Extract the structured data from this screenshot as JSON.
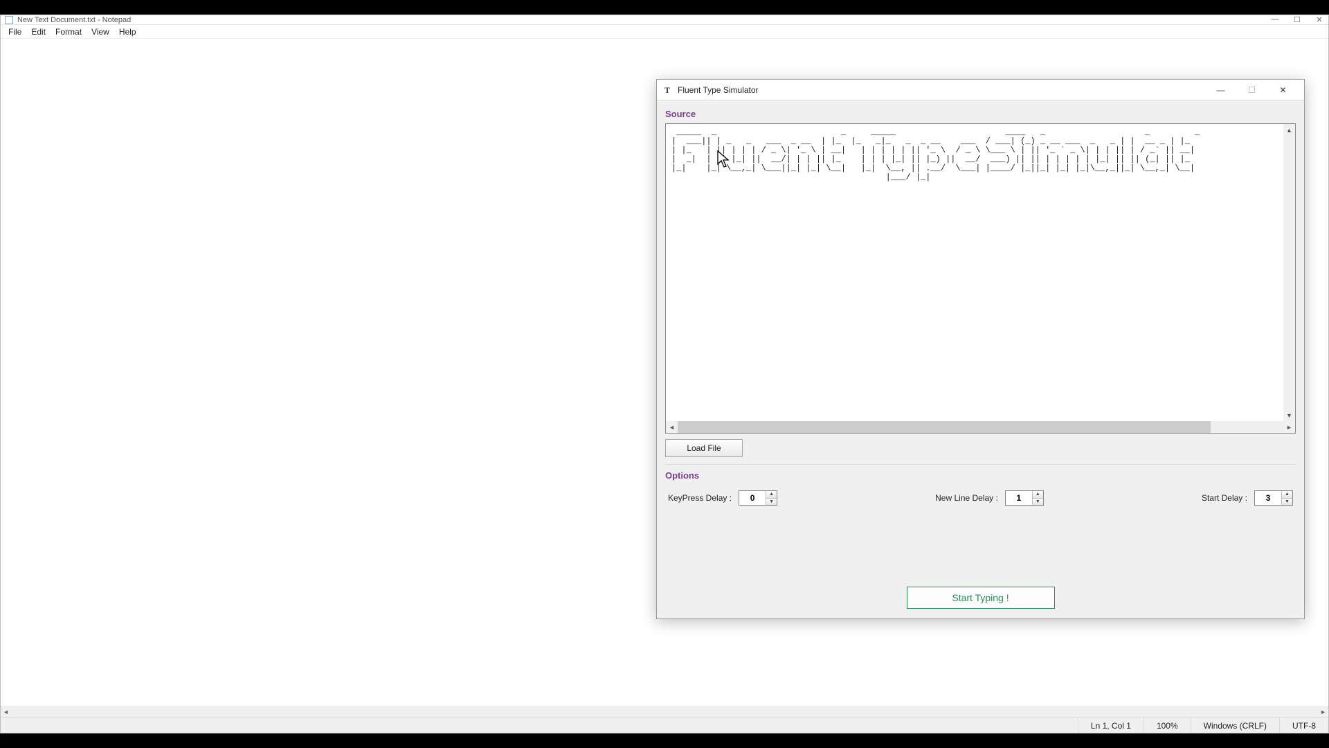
{
  "notepad": {
    "title": "New Text Document.txt - Notepad",
    "menu": {
      "file": "File",
      "edit": "Edit",
      "format": "Format",
      "view": "View",
      "help": "Help"
    },
    "status": {
      "position": "Ln 1, Col 1",
      "zoom": "100%",
      "lineending": "Windows (CRLF)",
      "encoding": "UTF-8"
    }
  },
  "dialog": {
    "title": "Fluent Type Simulator",
    "source_label": "Source",
    "ascii_art": " _____  _                         _     _____                      ____   _                    _         _   \n|  ___|| | _   _   ___  _ __  | |_  |_   _|_   _  _ __    ___  / ___| (_) _ __ ___  _   _ | |  __ _ | |_ \n| |_   | || | | | / _ \\| '_ \\ | __|   | | | | | || '_ \\  / _ \\ \\___ \\ | || '_ ` _ \\| | | || | / _` || __|\n|  _|  | || |_| ||  __/| | | || |_    | | | |_| || |_) ||  __/  ___) || || | | | | | |_| || || (_| || |_ \n|_|    |_| \\__,_| \\___||_| |_| \\__|   |_|  \\__, || .__/  \\___| |____/ |_||_| |_| |_|\\__,_||_| \\__,_| \\__|\n                                           |___/ |_|                                                     ",
    "load_file": "Load File",
    "options_label": "Options",
    "options": {
      "keypress_label": "KeyPress Delay :",
      "keypress_value": "0",
      "newline_label": "New Line Delay :",
      "newline_value": "1",
      "start_label": "Start Delay :",
      "start_value": "3"
    },
    "start_button": "Start Typing !"
  }
}
